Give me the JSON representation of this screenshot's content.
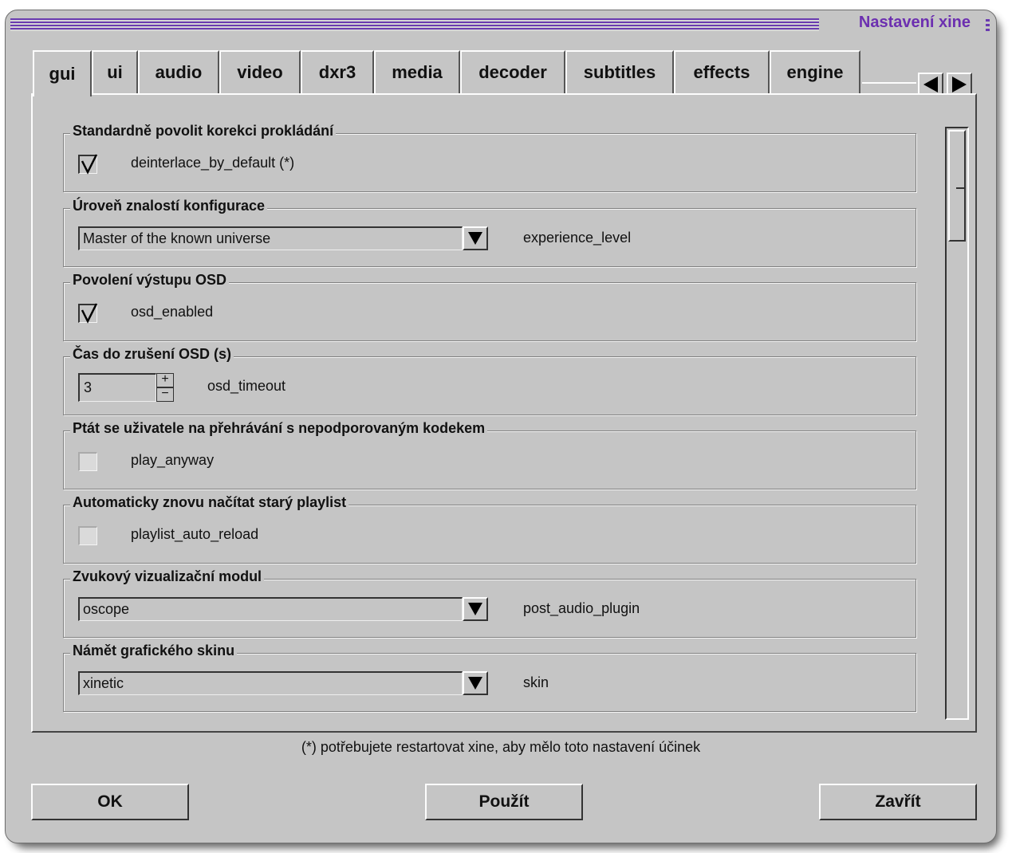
{
  "window": {
    "title": "Nastavení xine"
  },
  "tabs": [
    "gui",
    "ui",
    "audio",
    "video",
    "dxr3",
    "media",
    "decoder",
    "subtitles",
    "effects",
    "engine"
  ],
  "active_tab": "gui",
  "groups": [
    {
      "legend": "Standardně povolit korekci prokládání",
      "key": "deinterlace_by_default (*)",
      "checked": true
    },
    {
      "legend": "Úroveň znalostí konfigurace",
      "value": "Master of the known universe",
      "key": "experience_level"
    },
    {
      "legend": "Povolení výstupu OSD",
      "key": "osd_enabled",
      "checked": true
    },
    {
      "legend": "Čas do zrušení OSD (s)",
      "value": "3",
      "key": "osd_timeout"
    },
    {
      "legend": "Ptát se uživatele na přehrávání s nepodporovaným kodekem",
      "key": "play_anyway",
      "checked": false
    },
    {
      "legend": "Automaticky znovu načítat starý playlist",
      "key": "playlist_auto_reload",
      "checked": false
    },
    {
      "legend": "Zvukový vizualizační modul",
      "value": "oscope",
      "key": "post_audio_plugin"
    },
    {
      "legend": "Námět grafického skinu",
      "value": "xinetic",
      "key": "skin"
    }
  ],
  "spin": {
    "plus": "+",
    "minus": "−"
  },
  "footer": {
    "note": "(*)  potřebujete restartovat xine, aby mělo toto nastavení účinek",
    "ok": "OK",
    "apply": "Použít",
    "close": "Zavřít"
  },
  "icons": {
    "tab_left": "arrow-left-icon",
    "tab_right": "arrow-right-icon",
    "combo": "triangle-down-icon",
    "check": "checkmark-icon"
  },
  "colors": {
    "title_accent": "#6c2fb0",
    "background": "#c5c5c5"
  }
}
